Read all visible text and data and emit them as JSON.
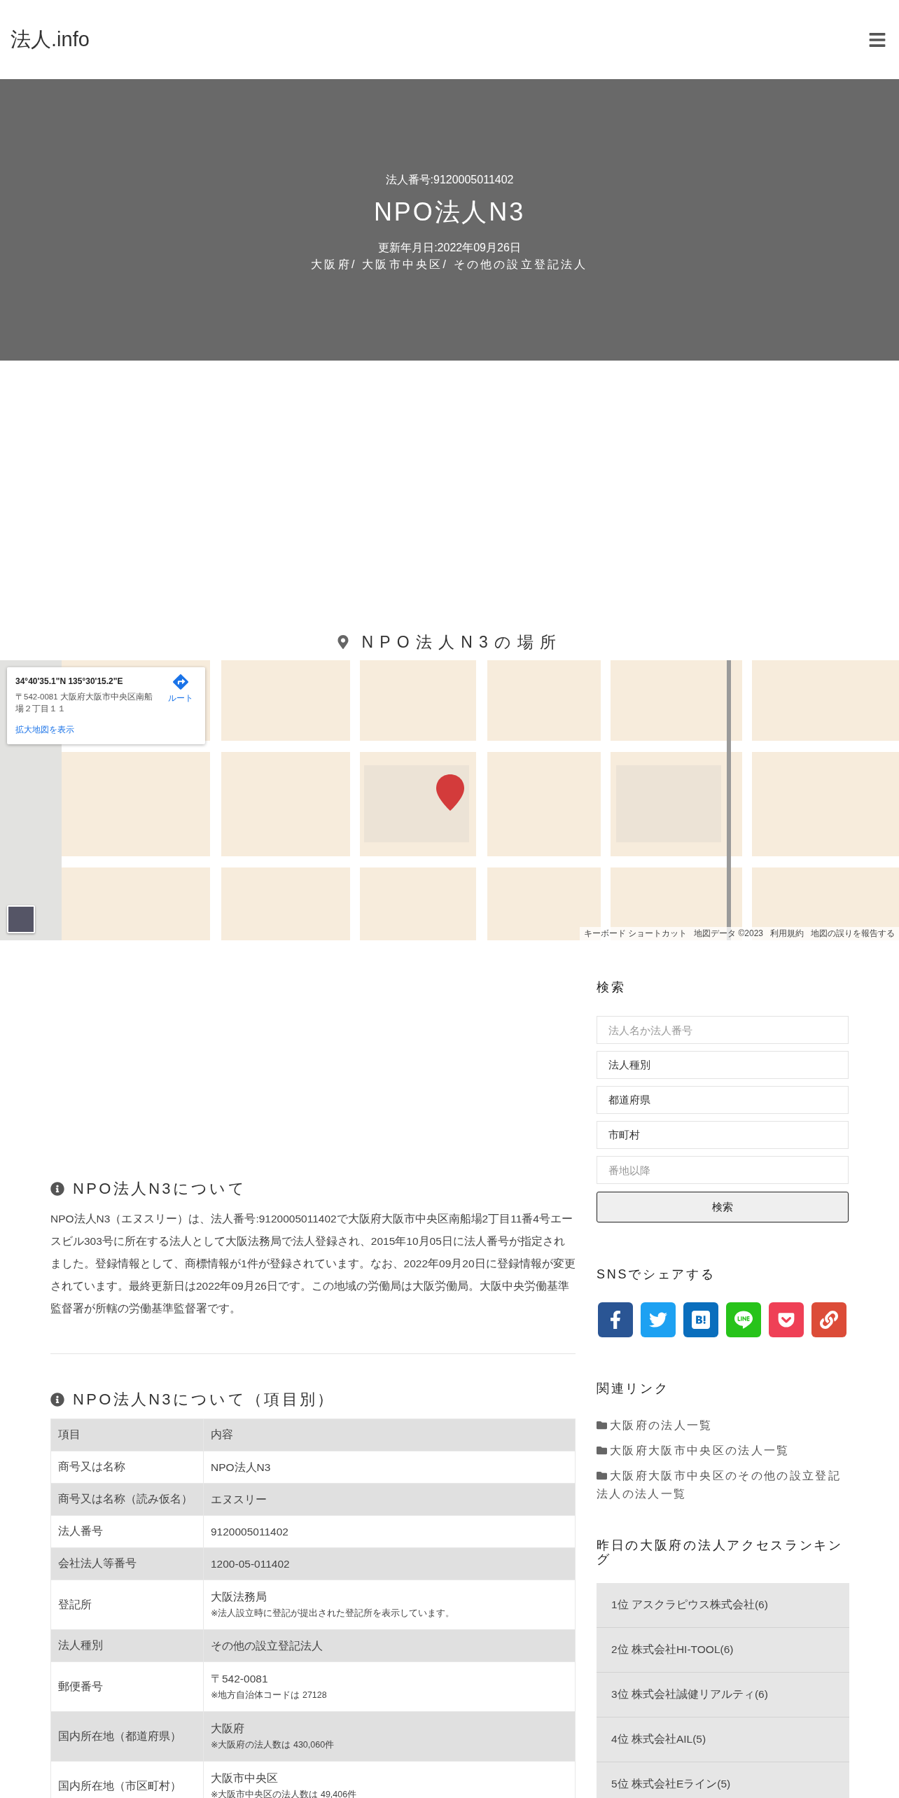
{
  "header": {
    "logo": "法人.info"
  },
  "hero": {
    "number": "法人番号:9120005011402",
    "title": "NPO法人N3",
    "updated": "更新年月日:2022年09月26日",
    "breadcrumb": "大阪府/ 大阪市中央区/ その他の設立登記法人"
  },
  "map_section": {
    "heading": "NPO法人N3の場所",
    "info_card": {
      "coords": "34°40'35.1\"N 135°30'15.2\"E",
      "address": "〒542-0081 大阪府大阪市中央区南船場２丁目１１",
      "route": "ルート",
      "larger_map": "拡大地図を表示"
    },
    "attribution": [
      "キーボード ショートカット",
      "地図データ ©2023",
      "利用規約",
      "地図の誤りを報告する"
    ]
  },
  "about": {
    "heading": "NPO法人N3について",
    "text": "NPO法人N3（エヌスリー）は、法人番号:9120005011402で大阪府大阪市中央区南船場2丁目11番4号エースビル303号に所在する法人として大阪法務局で法人登録され、2015年10月05日に法人番号が指定されました。登録情報として、商標情報が1件が登録されています。なお、2022年09月20日に登録情報が変更されています。最終更新日は2022年09月26日です。この地域の労働局は大阪労働局。大阪中央労働基準監督署が所轄の労働基準監督署です。"
  },
  "details": {
    "heading": "NPO法人N3について（項目別）",
    "columns": [
      "項目",
      "内容"
    ],
    "rows": [
      {
        "label": "商号又は名称",
        "value": "NPO法人N3"
      },
      {
        "label": "商号又は名称（読み仮名）",
        "value": "エヌスリー"
      },
      {
        "label": "法人番号",
        "value": "9120005011402"
      },
      {
        "label": "会社法人等番号",
        "value": "1200-05-011402"
      },
      {
        "label": "登記所",
        "value": "大阪法務局",
        "note": "※法人設立時に登記が提出された登記所を表示しています。"
      },
      {
        "label": "法人種別",
        "value": "その他の設立登記法人"
      },
      {
        "label": "郵便番号",
        "value": "〒542-0081",
        "note": "※地方自治体コードは 27128"
      },
      {
        "label": "国内所在地（都道府県）",
        "value": "大阪府",
        "note": "※大阪府の法人数は 430,060件"
      },
      {
        "label": "国内所在地（市区町村）",
        "value": "大阪市中央区",
        "note": "※大阪市中央区の法人数は 49,406件"
      }
    ]
  },
  "sidebar": {
    "search": {
      "heading": "検索",
      "fields": [
        {
          "kind": "input",
          "placeholder": "法人名か法人番号"
        },
        {
          "kind": "select",
          "value": "法人種別"
        },
        {
          "kind": "select",
          "value": "都道府県"
        },
        {
          "kind": "select",
          "value": "市町村"
        },
        {
          "kind": "input",
          "placeholder": "番地以降"
        }
      ],
      "button": "検索"
    },
    "share": {
      "heading": "SNSでシェアする",
      "buttons": [
        {
          "kind": "facebook",
          "color": "#2a5594"
        },
        {
          "kind": "twitter",
          "color": "#1da1f2"
        },
        {
          "kind": "hatena",
          "color": "#0a6ebd"
        },
        {
          "kind": "line",
          "color": "#27c31a"
        },
        {
          "kind": "pocket",
          "color": "#ef4056"
        },
        {
          "kind": "link",
          "color": "#dc4c38"
        }
      ]
    },
    "related": {
      "heading": "関連リンク",
      "links": [
        "大阪府の法人一覧",
        "大阪府大阪市中央区の法人一覧",
        "大阪府大阪市中央区のその他の設立登記法人の法人一覧"
      ]
    },
    "ranking": {
      "heading": "昨日の大阪府の法人アクセスランキング",
      "items": [
        "1位 アスクラピウス株式会社(6)",
        "2位 株式会社HI-TOOL(6)",
        "3位 株式会社誠健リアルティ(6)",
        "4位 株式会社AIL(5)",
        "5位 株式会社Eライン(5)"
      ]
    }
  }
}
